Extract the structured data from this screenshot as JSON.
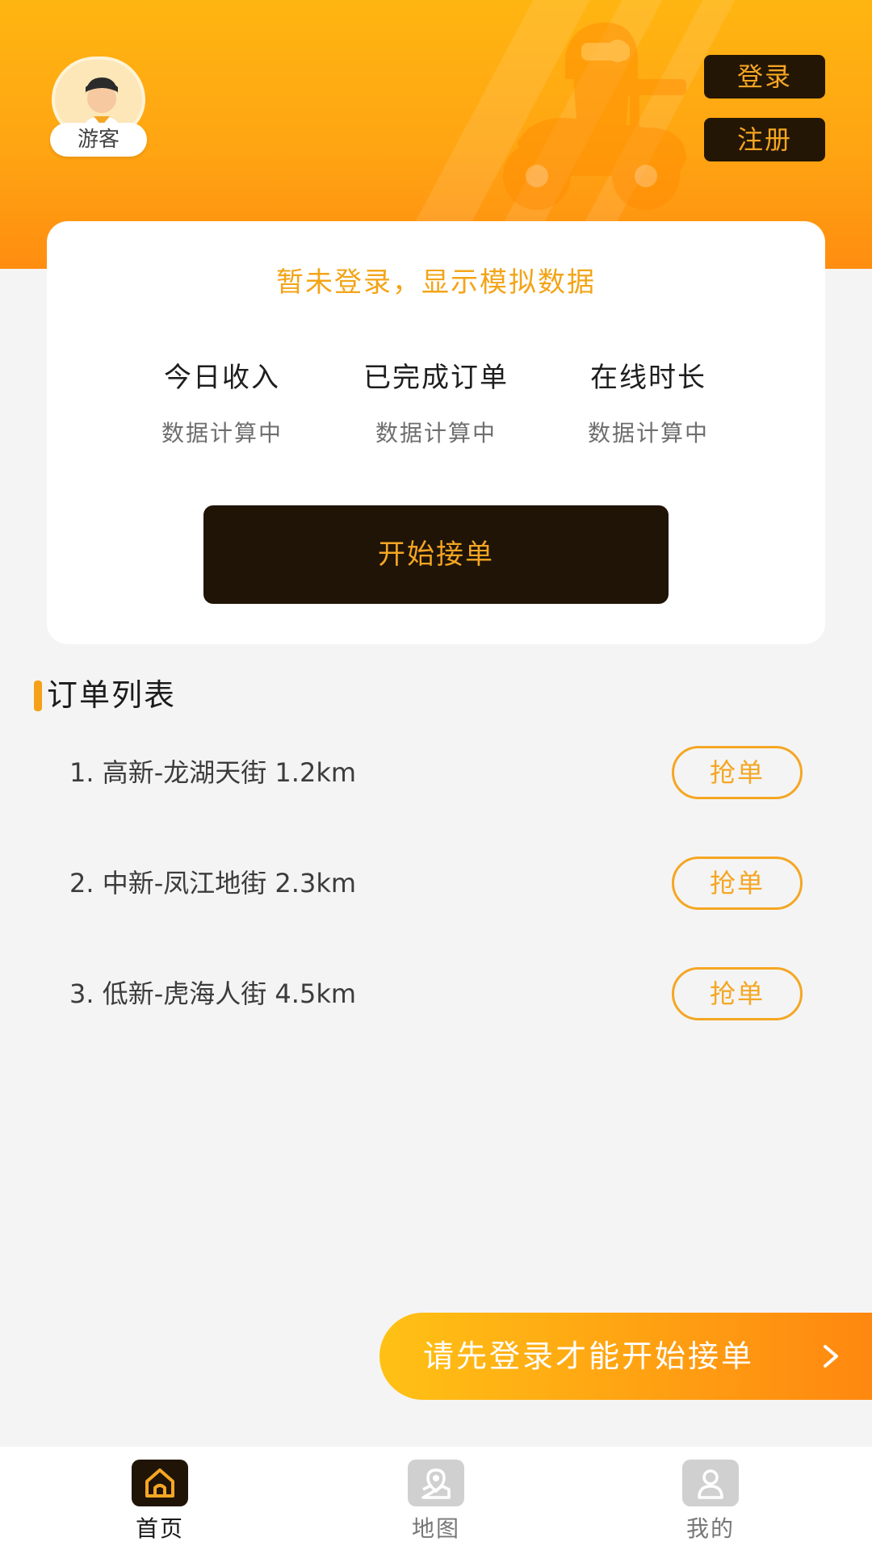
{
  "header": {
    "user_label": "游客",
    "login_label": "登录",
    "register_label": "注册"
  },
  "stats_card": {
    "notice": "暂未登录，显示模拟数据",
    "stats": [
      {
        "title": "今日收入",
        "value": "数据计算中"
      },
      {
        "title": "已完成订单",
        "value": "数据计算中"
      },
      {
        "title": "在线时长",
        "value": "数据计算中"
      }
    ],
    "start_label": "开始接单"
  },
  "orders": {
    "title": "订单列表",
    "items": [
      {
        "text": "1. 高新-龙湖天街 1.2km",
        "action": "抢单"
      },
      {
        "text": "2. 中新-凤江地街 2.3km",
        "action": "抢单"
      },
      {
        "text": "3. 低新-虎海人街 4.5km",
        "action": "抢单"
      }
    ]
  },
  "login_banner": {
    "text": "请先登录才能开始接单",
    "chevron_icon": "chevron-right-icon"
  },
  "tabbar": {
    "tabs": [
      {
        "label": "首页",
        "icon": "home-icon",
        "active": true
      },
      {
        "label": "地图",
        "icon": "map-icon",
        "active": false
      },
      {
        "label": "我的",
        "icon": "user-icon",
        "active": false
      }
    ]
  },
  "colors": {
    "accent": "#f5a623",
    "header_top": "#ffb511",
    "header_bottom": "#ff8d10",
    "dark": "#201406",
    "background": "#f4f4f4"
  }
}
